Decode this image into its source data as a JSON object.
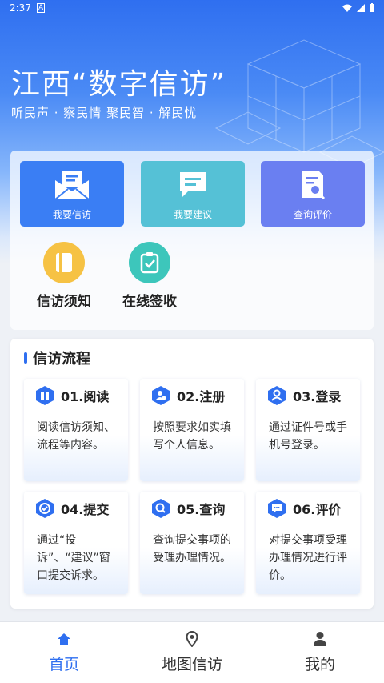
{
  "status_bar": {
    "time": "2:37",
    "indicator": "A"
  },
  "hero": {
    "title": "江西“数字信访”",
    "subtitle": "听民声 · 察民情 聚民智 · 解民忧"
  },
  "quick_actions": [
    {
      "label": "我要信访",
      "icon": "mail-letter-icon",
      "color": "#3a7ef4"
    },
    {
      "label": "我要建议",
      "icon": "chat-bubble-icon",
      "color": "#55c1d6"
    },
    {
      "label": "查询评价",
      "icon": "document-search-icon",
      "color": "#6a7ff1"
    }
  ],
  "secondary_actions": [
    {
      "label": "信访须知",
      "icon": "book-icon",
      "color": "#f6c244"
    },
    {
      "label": "在线签收",
      "icon": "clipboard-check-icon",
      "color": "#3dc6bb"
    }
  ],
  "flow": {
    "title": "信访流程",
    "steps": [
      {
        "title": "01.阅读",
        "desc": "阅读信访须知、流程等内容。",
        "icon": "read-book-icon"
      },
      {
        "title": "02.注册",
        "desc": "按照要求如实填写个人信息。",
        "icon": "register-user-icon"
      },
      {
        "title": "03.登录",
        "desc": "通过证件号或手机号登录。",
        "icon": "login-user-icon"
      },
      {
        "title": "04.提交",
        "desc": "通过“投诉”、“建议”窗口提交诉求。",
        "icon": "submit-check-icon"
      },
      {
        "title": "05.查询",
        "desc": "查询提交事项的受理办理情况。",
        "icon": "search-icon"
      },
      {
        "title": "06.评价",
        "desc": "对提交事项受理办理情况进行评价。",
        "icon": "comment-icon"
      }
    ]
  },
  "tabbar": {
    "tabs": [
      {
        "label": "首页",
        "icon": "home-icon",
        "active": true
      },
      {
        "label": "地图信访",
        "icon": "map-pin-icon",
        "active": false
      },
      {
        "label": "我的",
        "icon": "person-icon",
        "active": false
      }
    ]
  },
  "colors": {
    "accent": "#2f6ff0"
  }
}
